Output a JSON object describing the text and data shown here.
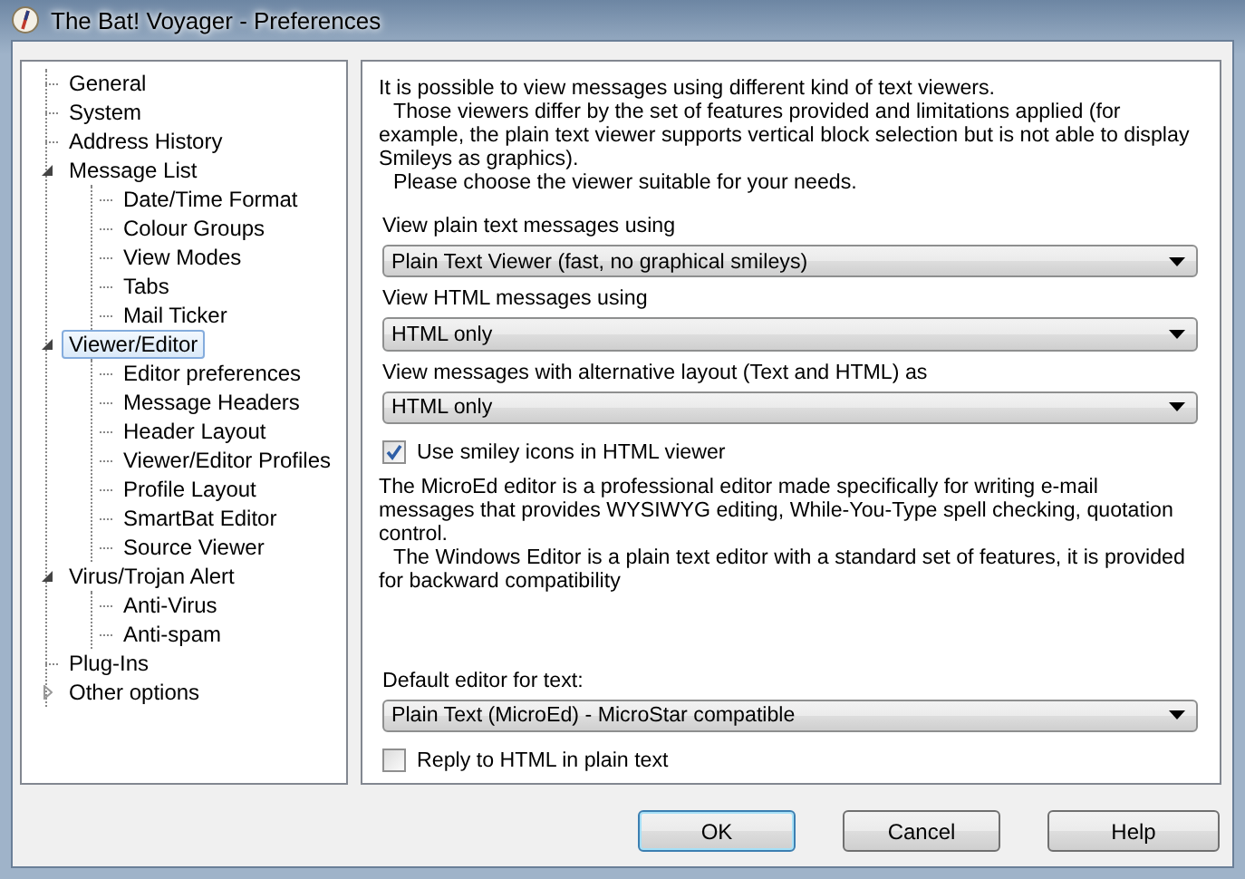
{
  "window": {
    "title": "The Bat! Voyager - Preferences"
  },
  "tree": [
    {
      "label": "General",
      "selected": false
    },
    {
      "label": "System",
      "selected": false
    },
    {
      "label": "Address History",
      "selected": false
    },
    {
      "label": "Message List",
      "selected": false,
      "expanded": true,
      "children": [
        {
          "label": "Date/Time Format",
          "selected": false
        },
        {
          "label": "Colour Groups",
          "selected": false
        },
        {
          "label": "View Modes",
          "selected": false
        },
        {
          "label": "Tabs",
          "selected": false
        },
        {
          "label": "Mail Ticker",
          "selected": false
        }
      ]
    },
    {
      "label": "Viewer/Editor",
      "selected": true,
      "expanded": true,
      "children": [
        {
          "label": "Editor preferences",
          "selected": false
        },
        {
          "label": "Message Headers",
          "selected": false
        },
        {
          "label": "Header Layout",
          "selected": false
        },
        {
          "label": "Viewer/Editor Profiles",
          "selected": false
        },
        {
          "label": "Profile Layout",
          "selected": false
        },
        {
          "label": "SmartBat Editor",
          "selected": false
        },
        {
          "label": "Source Viewer",
          "selected": false
        }
      ]
    },
    {
      "label": "Virus/Trojan Alert",
      "selected": false,
      "expanded": true,
      "children": [
        {
          "label": "Anti-Virus",
          "selected": false
        },
        {
          "label": "Anti-spam",
          "selected": false
        }
      ]
    },
    {
      "label": "Plug-Ins",
      "selected": false
    },
    {
      "label": "Other options",
      "selected": false,
      "expanded": false
    }
  ],
  "panel": [
    {
      "kind": "text",
      "paragraphs": [
        {
          "text": "It is possible to view messages using different kind of text viewers.",
          "indent": false
        },
        {
          "text": "Those viewers differ by the set of features provided and limitations applied (for example, the plain text viewer supports vertical block selection but is not able to display Smileys as graphics).",
          "indent": true
        },
        {
          "text": "Please choose the viewer suitable for your needs.",
          "indent": true
        }
      ]
    },
    {
      "kind": "dropdown",
      "label": "View plain text messages using",
      "value": "Plain Text Viewer (fast, no graphical smileys)"
    },
    {
      "kind": "dropdown",
      "label": "View HTML messages using",
      "value": "HTML only"
    },
    {
      "kind": "dropdown",
      "label": "View messages with alternative layout (Text and HTML) as",
      "value": "HTML only"
    },
    {
      "kind": "checkbox",
      "label": "Use smiley icons in HTML viewer",
      "checked": true
    },
    {
      "kind": "text",
      "paragraphs": [
        {
          "text": "The MicroEd editor is a professional editor made specifically for writing e-mail messages that provides WYSIWYG editing, While-You-Type spell checking, quotation control.",
          "indent": false
        },
        {
          "text": "The Windows Editor is a plain text editor with a standard set of features, it is provided for backward compatibility",
          "indent": true
        }
      ]
    },
    {
      "kind": "spacer"
    },
    {
      "kind": "dropdown",
      "label": "Default editor for text:",
      "value": "Plain Text (MicroEd)  - MicroStar compatible"
    },
    {
      "kind": "checkbox",
      "label": "Reply to HTML in plain text",
      "checked": false
    }
  ],
  "buttons": [
    {
      "label": "OK",
      "default": true
    },
    {
      "label": "Cancel",
      "default": false
    },
    {
      "label": "Help",
      "default": false
    }
  ]
}
